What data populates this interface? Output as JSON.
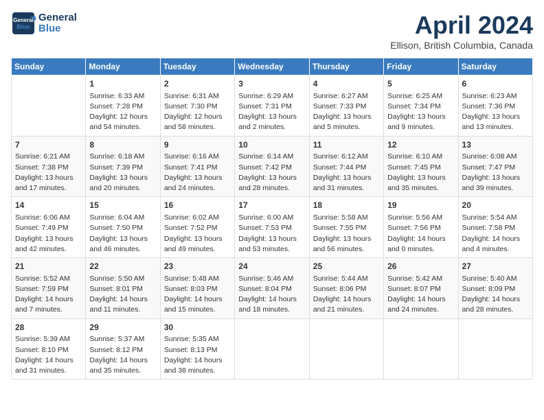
{
  "header": {
    "logo_line1": "General",
    "logo_line2": "Blue",
    "month": "April 2024",
    "location": "Ellison, British Columbia, Canada"
  },
  "days_of_week": [
    "Sunday",
    "Monday",
    "Tuesday",
    "Wednesday",
    "Thursday",
    "Friday",
    "Saturday"
  ],
  "weeks": [
    [
      {
        "day": "",
        "info": ""
      },
      {
        "day": "1",
        "info": "Sunrise: 6:33 AM\nSunset: 7:28 PM\nDaylight: 12 hours\nand 54 minutes."
      },
      {
        "day": "2",
        "info": "Sunrise: 6:31 AM\nSunset: 7:30 PM\nDaylight: 12 hours\nand 58 minutes."
      },
      {
        "day": "3",
        "info": "Sunrise: 6:29 AM\nSunset: 7:31 PM\nDaylight: 13 hours\nand 2 minutes."
      },
      {
        "day": "4",
        "info": "Sunrise: 6:27 AM\nSunset: 7:33 PM\nDaylight: 13 hours\nand 5 minutes."
      },
      {
        "day": "5",
        "info": "Sunrise: 6:25 AM\nSunset: 7:34 PM\nDaylight: 13 hours\nand 9 minutes."
      },
      {
        "day": "6",
        "info": "Sunrise: 6:23 AM\nSunset: 7:36 PM\nDaylight: 13 hours\nand 13 minutes."
      }
    ],
    [
      {
        "day": "7",
        "info": "Sunrise: 6:21 AM\nSunset: 7:38 PM\nDaylight: 13 hours\nand 17 minutes."
      },
      {
        "day": "8",
        "info": "Sunrise: 6:18 AM\nSunset: 7:39 PM\nDaylight: 13 hours\nand 20 minutes."
      },
      {
        "day": "9",
        "info": "Sunrise: 6:16 AM\nSunset: 7:41 PM\nDaylight: 13 hours\nand 24 minutes."
      },
      {
        "day": "10",
        "info": "Sunrise: 6:14 AM\nSunset: 7:42 PM\nDaylight: 13 hours\nand 28 minutes."
      },
      {
        "day": "11",
        "info": "Sunrise: 6:12 AM\nSunset: 7:44 PM\nDaylight: 13 hours\nand 31 minutes."
      },
      {
        "day": "12",
        "info": "Sunrise: 6:10 AM\nSunset: 7:45 PM\nDaylight: 13 hours\nand 35 minutes."
      },
      {
        "day": "13",
        "info": "Sunrise: 6:08 AM\nSunset: 7:47 PM\nDaylight: 13 hours\nand 39 minutes."
      }
    ],
    [
      {
        "day": "14",
        "info": "Sunrise: 6:06 AM\nSunset: 7:49 PM\nDaylight: 13 hours\nand 42 minutes."
      },
      {
        "day": "15",
        "info": "Sunrise: 6:04 AM\nSunset: 7:50 PM\nDaylight: 13 hours\nand 46 minutes."
      },
      {
        "day": "16",
        "info": "Sunrise: 6:02 AM\nSunset: 7:52 PM\nDaylight: 13 hours\nand 49 minutes."
      },
      {
        "day": "17",
        "info": "Sunrise: 6:00 AM\nSunset: 7:53 PM\nDaylight: 13 hours\nand 53 minutes."
      },
      {
        "day": "18",
        "info": "Sunrise: 5:58 AM\nSunset: 7:55 PM\nDaylight: 13 hours\nand 56 minutes."
      },
      {
        "day": "19",
        "info": "Sunrise: 5:56 AM\nSunset: 7:56 PM\nDaylight: 14 hours\nand 0 minutes."
      },
      {
        "day": "20",
        "info": "Sunrise: 5:54 AM\nSunset: 7:58 PM\nDaylight: 14 hours\nand 4 minutes."
      }
    ],
    [
      {
        "day": "21",
        "info": "Sunrise: 5:52 AM\nSunset: 7:59 PM\nDaylight: 14 hours\nand 7 minutes."
      },
      {
        "day": "22",
        "info": "Sunrise: 5:50 AM\nSunset: 8:01 PM\nDaylight: 14 hours\nand 11 minutes."
      },
      {
        "day": "23",
        "info": "Sunrise: 5:48 AM\nSunset: 8:03 PM\nDaylight: 14 hours\nand 15 minutes."
      },
      {
        "day": "24",
        "info": "Sunrise: 5:46 AM\nSunset: 8:04 PM\nDaylight: 14 hours\nand 18 minutes."
      },
      {
        "day": "25",
        "info": "Sunrise: 5:44 AM\nSunset: 8:06 PM\nDaylight: 14 hours\nand 21 minutes."
      },
      {
        "day": "26",
        "info": "Sunrise: 5:42 AM\nSunset: 8:07 PM\nDaylight: 14 hours\nand 24 minutes."
      },
      {
        "day": "27",
        "info": "Sunrise: 5:40 AM\nSunset: 8:09 PM\nDaylight: 14 hours\nand 28 minutes."
      }
    ],
    [
      {
        "day": "28",
        "info": "Sunrise: 5:39 AM\nSunset: 8:10 PM\nDaylight: 14 hours\nand 31 minutes."
      },
      {
        "day": "29",
        "info": "Sunrise: 5:37 AM\nSunset: 8:12 PM\nDaylight: 14 hours\nand 35 minutes."
      },
      {
        "day": "30",
        "info": "Sunrise: 5:35 AM\nSunset: 8:13 PM\nDaylight: 14 hours\nand 38 minutes."
      },
      {
        "day": "",
        "info": ""
      },
      {
        "day": "",
        "info": ""
      },
      {
        "day": "",
        "info": ""
      },
      {
        "day": "",
        "info": ""
      }
    ]
  ]
}
